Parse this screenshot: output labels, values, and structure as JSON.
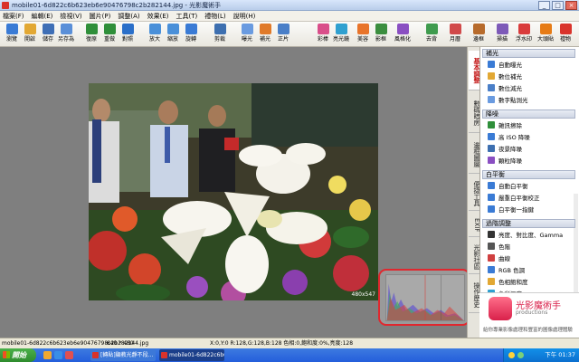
{
  "window": {
    "title": "mobile01-6d822c6b623eb6e90476798c2b282144.jpg - 光影魔術手",
    "min": "_",
    "max": "□",
    "close": "×"
  },
  "menubar": [
    "檔案(F)",
    "編輯(E)",
    "檢視(V)",
    "圖片(P)",
    "調整(A)",
    "效果(E)",
    "工具(T)",
    "禮物(L)",
    "說明(H)"
  ],
  "toolbar": {
    "left": [
      {
        "label": "瀏覽",
        "color": "#3a7bd5"
      },
      {
        "label": "開啟",
        "color": "#e2a834"
      },
      {
        "label": "儲存",
        "color": "#3f6fb6"
      },
      {
        "label": "另存為",
        "color": "#5a8fd8"
      },
      {
        "label": "復原",
        "color": "#2f8f3a"
      },
      {
        "label": "重做",
        "color": "#2f8f3a"
      },
      {
        "label": "對照",
        "color": "#2a6fc9"
      },
      {
        "label": "放大",
        "color": "#4a90d9"
      },
      {
        "label": "縮放",
        "color": "#4a90d9"
      },
      {
        "label": "旋轉",
        "color": "#3a7bd5"
      },
      {
        "label": "剪裁",
        "color": "#3d6fb0"
      },
      {
        "label": "曝光",
        "color": "#6a9be0"
      },
      {
        "label": "補光",
        "color": "#e07a2a"
      },
      {
        "label": "正片",
        "color": "#4a7fc8"
      },
      {
        "label": "彩棒",
        "color": "#d94e8a"
      },
      {
        "label": "亮光鏡",
        "color": "#2fa0d0"
      },
      {
        "label": "美容",
        "color": "#e8742a"
      },
      {
        "label": "影框",
        "color": "#3b8e3f"
      },
      {
        "label": "風格化",
        "color": "#8a4fc2"
      }
    ],
    "right": [
      {
        "label": "去背",
        "color": "#3f9b4e"
      },
      {
        "label": "月曆",
        "color": "#d14a4a"
      },
      {
        "label": "邊框",
        "color": "#b76b2c"
      },
      {
        "label": "掃描",
        "color": "#7d5ab8"
      },
      {
        "label": "浮水印",
        "color": "#d93b3b"
      },
      {
        "label": "大頭貼",
        "color": "#e67b16"
      },
      {
        "label": "禮物",
        "color": "#d9332b"
      }
    ]
  },
  "canvas": {
    "photo_size": "480x547",
    "photo_description": "photo"
  },
  "vertical_tabs": [
    "基本調整",
    "數碼暗房",
    "邊框圖層",
    "便捷工具",
    "EXIF",
    "光影社區",
    "操作歷史"
  ],
  "side_panel": {
    "sections": [
      {
        "title": "補光",
        "items": [
          {
            "label": "自動曝光",
            "color": "#3a7bd5"
          },
          {
            "label": "數位補光",
            "color": "#e2a834"
          },
          {
            "label": "數位減光",
            "color": "#4a7fc8"
          },
          {
            "label": "數字點測光",
            "color": "#6a9be0"
          }
        ]
      },
      {
        "title": "降噪",
        "items": [
          {
            "label": "雜訊擦除",
            "color": "#2f8f3a"
          },
          {
            "label": "高 ISO 降噪",
            "color": "#3a7bd5"
          },
          {
            "label": "夜景降噪",
            "color": "#3d6fb0"
          },
          {
            "label": "顆粒降噪",
            "color": "#8a4fc2"
          }
        ]
      },
      {
        "title": "白平衡",
        "items": [
          {
            "label": "自動白平衡",
            "color": "#3a7bd5"
          },
          {
            "label": "嚴重白平衡校正",
            "color": "#3a7bd5"
          },
          {
            "label": "白平衡一指鍵",
            "color": "#3a7bd5"
          }
        ]
      },
      {
        "title": "過階調整",
        "items": [
          {
            "label": "亮度、對比度、Gamma",
            "color": "#333333"
          },
          {
            "label": "色階",
            "color": "#555555"
          },
          {
            "label": "曲線",
            "color": "#d04040"
          },
          {
            "label": "RGB 色調",
            "color": "#3a7bd5"
          },
          {
            "label": "色相飽和度",
            "color": "#e2a834"
          },
          {
            "label": "色彩溫度",
            "color": "#2fa0d0"
          }
        ]
      }
    ]
  },
  "promo": {
    "title": "光影魔術手",
    "subtitle": "productions",
    "note": "給你專業影像處理和豐富的圖像處理體驗"
  },
  "statusbar": {
    "file": "mobile01-6d822c6b623eb6e90476798c2b282144.jpg",
    "dimensions": "640 * 480",
    "info": "X:0,Y:0 R:128,G:128,B:128  色相:0,飽和度:0%,亮度:128"
  },
  "taskbar": {
    "start": "開始",
    "tasks": [
      {
        "label": "[轉貼]顯教光靜不段...",
        "color": "#2a5bb8",
        "active": false
      },
      {
        "label": "mobile01-6d822c6b62...",
        "color": "#1e4fa8",
        "active": true
      }
    ],
    "clock": "下午 01:37"
  },
  "colors": {
    "canvas_bg": "#7f7f7f",
    "highlight_ring": "#e0282f",
    "accent_tab": "#c21212"
  }
}
